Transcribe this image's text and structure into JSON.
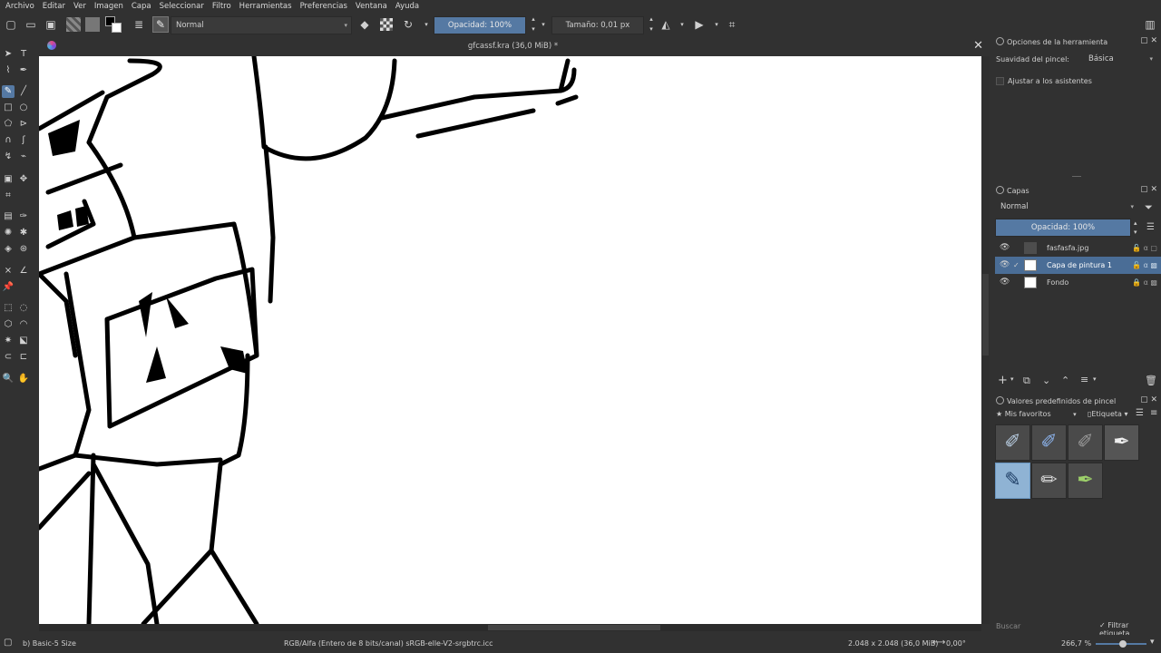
{
  "menu": [
    "Archivo",
    "Editar",
    "Ver",
    "Imagen",
    "Capa",
    "Seleccionar",
    "Filtro",
    "Herramientas",
    "Preferencias",
    "Ventana",
    "Ayuda"
  ],
  "toolbar": {
    "blend_mode": "Normal",
    "opacity_label": "Opacidad: 100%",
    "size_label": "Tamaño: 0,01 px"
  },
  "document": {
    "title": "gfcassf.kra (36,0 MiB) *"
  },
  "tool_options": {
    "title": "Opciones de la herramienta",
    "smoothing_label": "Suavidad del pincel:",
    "smoothing_value": "Básica",
    "snap_label": "Ajustar a los asistentes"
  },
  "layers": {
    "title": "Capas",
    "blend_mode": "Normal",
    "opacity_label": "Opacidad:  100%",
    "items": [
      {
        "name": "fasfasfa.jpg"
      },
      {
        "name": "Capa de pintura 1"
      },
      {
        "name": "Fondo"
      }
    ]
  },
  "presets": {
    "title": "Valores predefinidos de pincel",
    "filter": "Mis favoritos",
    "tag_label": "Etiqueta",
    "search_placeholder": "Buscar",
    "filter_tag_label": "Filtrar etiqueta"
  },
  "status": {
    "brush": "b) Basic-5 Size",
    "color_space": "RGB/Alfa (Entero de 8 bits/canal)  sRGB-elle-V2-srgbtrc.icc",
    "image_size": "2.048 x 2.048 (36,0 MiB)",
    "rotation": "0,00°",
    "zoom": "266,7 %"
  },
  "colors": {
    "accent": "#5579a3",
    "selected_layer": "#4a6d96",
    "background": "#313131",
    "canvas": "#ffffff"
  }
}
